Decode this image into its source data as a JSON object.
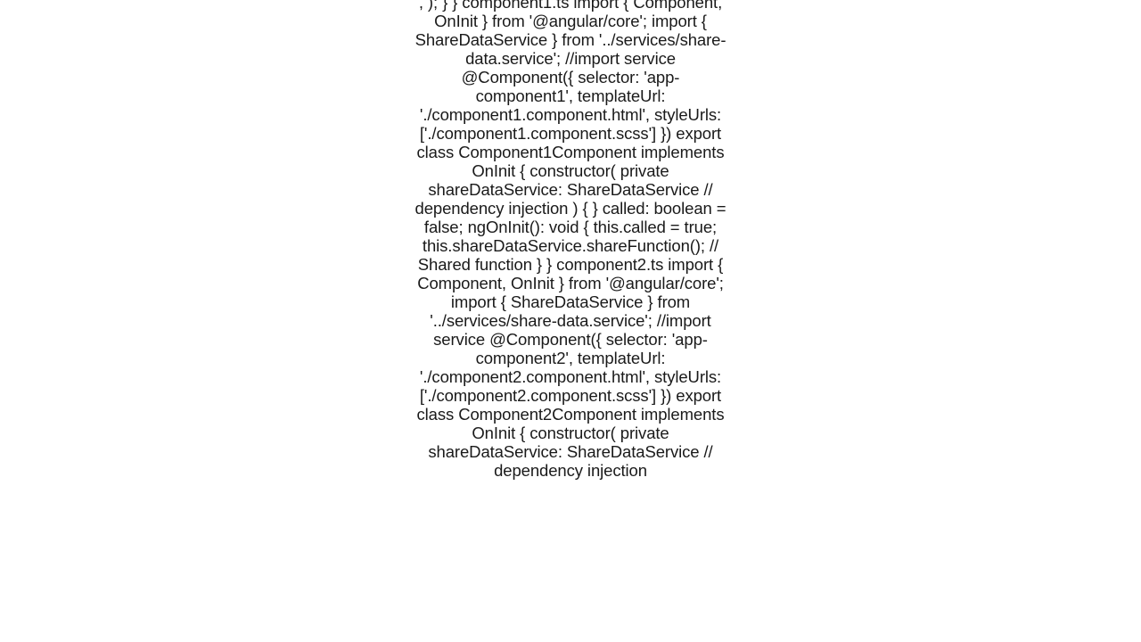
{
  "article": {
    "body": ", ); } }  component1.ts import { Component, OnInit } from '@angular/core'; import { ShareDataService } from '../services/share-data.service'; //import service  @Component({   selector: 'app-component1',   templateUrl: './component1.component.html',   styleUrls: ['./component1.component.scss'] }) export class Component1Component implements OnInit {    constructor(     private shareDataService: ShareDataService // dependency injection   ) { }    called: boolean = false;    ngOnInit(): void {     this.called = true;     this.shareDataService.shareFunction(); // Shared function    } }  component2.ts import { Component, OnInit } from '@angular/core'; import { ShareDataService } from '../services/share-data.service'; //import service  @Component({   selector: 'app-component2',   templateUrl: './component2.component.html',   styleUrls: ['./component2.component.scss'] }) export class Component2Component implements OnInit {    constructor(     private shareDataService: ShareDataService // dependency injection"
  }
}
